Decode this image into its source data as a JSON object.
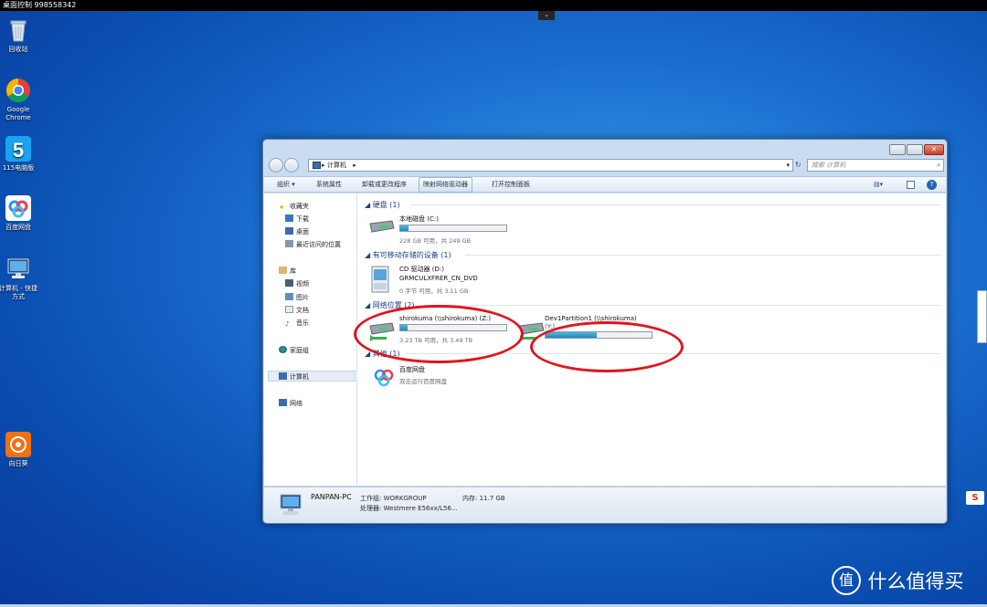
{
  "topbar": {
    "title": "桌面控制 998558342",
    "handle": "⌄"
  },
  "desktop": {
    "icons": [
      {
        "label": "回收站"
      },
      {
        "label": "Google Chrome"
      },
      {
        "label": "115电脑版"
      },
      {
        "label": "百度网盘"
      },
      {
        "label": "计算机 - 快捷方式"
      },
      {
        "label": "向日葵"
      }
    ]
  },
  "window": {
    "address": "计算机",
    "search_placeholder": "搜索 计算机",
    "toolbar": {
      "organize": "组织 ▾",
      "system_properties": "系统属性",
      "uninstall": "卸载或更改程序",
      "map_drive": "映射网络驱动器",
      "control_panel": "打开控制面板"
    },
    "nav": {
      "favorites": "收藏夹",
      "downloads": "下载",
      "desktop": "桌面",
      "recent": "最近访问的位置",
      "libraries": "库",
      "videos": "视频",
      "pictures": "图片",
      "documents": "文档",
      "music": "音乐",
      "homegroup": "家庭组",
      "computer": "计算机",
      "network": "网络"
    },
    "sections": {
      "hdd": "硬盘 (1)",
      "removable": "有可移动存储的设备 (1)",
      "network": "网络位置 (2)",
      "other": "其他 (1)"
    },
    "drives": {
      "c": {
        "name": "本地磁盘 (C:)",
        "info": "228 GB 可用，共 249 GB",
        "used": 0.08
      },
      "d": {
        "name": "CD 驱动器 (D:)",
        "label": "GRMCULXFRER_CN_DVD",
        "info": "0 字节 可用，共 3.11 GB"
      },
      "z": {
        "name": "shirokuma (\\\\shirokuma) (Z:)",
        "info": "3.23 TB 可用，共 3.49 TB",
        "used": 0.07
      },
      "y": {
        "name": "Dev1Partition1 (\\\\shirokuma)",
        "letter": "(Y:)",
        "used": 0.48
      },
      "baidu": {
        "name": "百度网盘",
        "info": "双击运行百度网盘"
      }
    },
    "status": {
      "pc_name": "PANPAN-PC",
      "workgroup": "工作组: WORKGROUP",
      "memory": "内存: 11.7 GB",
      "processor": "处理器: Westmere E56xx/L56..."
    }
  },
  "watermark": {
    "text": "什么值得买",
    "logo": "值"
  },
  "colors": {
    "accent": "#1d88c2",
    "annotation": "#e1141e",
    "section_title": "#1e3f8a"
  }
}
